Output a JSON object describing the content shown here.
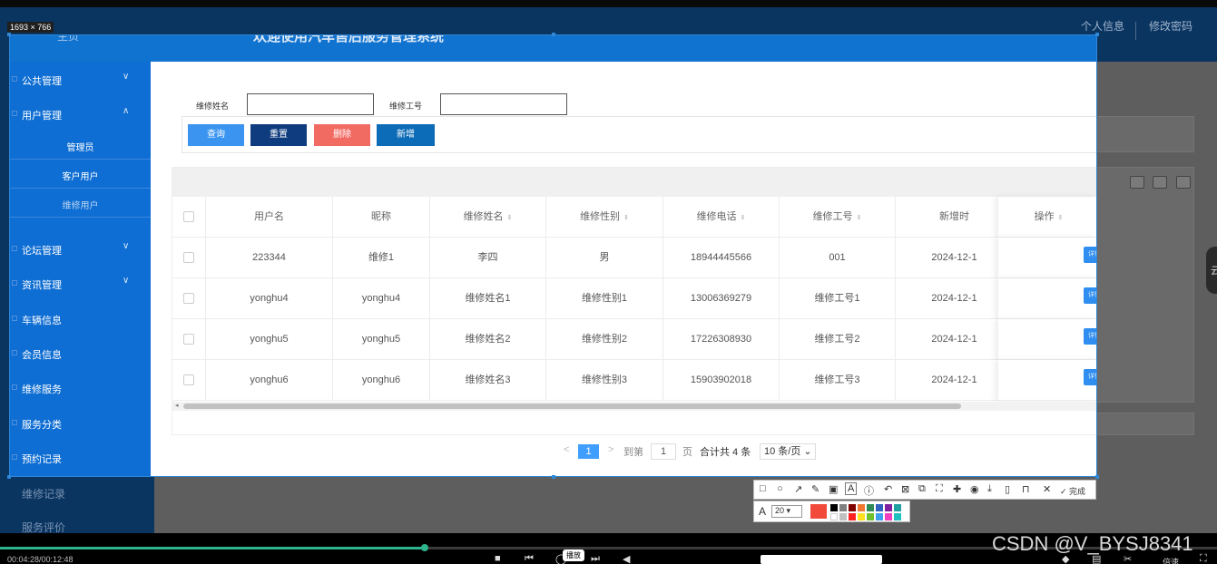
{
  "bg": {
    "top_links": [
      "个人信息",
      "修改密码"
    ],
    "sidebar_items": [
      "维修记录",
      "服务评价"
    ]
  },
  "capture": {
    "size_label": "1693 × 766",
    "home": "主页",
    "title": "欢迎使用汽车售后服务管理系统"
  },
  "sidebar": {
    "groups": [
      {
        "label": "公共管理",
        "chevron": "∨"
      },
      {
        "label": "用户管理",
        "chevron": "∧"
      }
    ],
    "sub_items": [
      "管理员",
      "客户用户",
      "维修用户"
    ],
    "items": [
      {
        "label": "论坛管理",
        "chevron": "∨"
      },
      {
        "label": "资讯管理",
        "chevron": "∨"
      },
      {
        "label": "车辆信息",
        "chevron": ""
      },
      {
        "label": "会员信息",
        "chevron": ""
      },
      {
        "label": "维修服务",
        "chevron": ""
      },
      {
        "label": "服务分类",
        "chevron": ""
      },
      {
        "label": "预约记录",
        "chevron": ""
      }
    ]
  },
  "search": {
    "name_label": "维修姓名",
    "id_label": "维修工号",
    "name_value": "",
    "id_value": ""
  },
  "buttons": {
    "query": "查询",
    "reset": "重置",
    "delete": "删除",
    "add": "新增"
  },
  "table": {
    "columns": [
      "用户名",
      "昵称",
      "维修姓名",
      "维修性别",
      "维修电话",
      "维修工号",
      "新增时"
    ],
    "sortable": [
      false,
      false,
      true,
      true,
      true,
      true,
      false
    ],
    "op_header": "操作",
    "sort_icon": "⇕",
    "detail_label": "详情",
    "rows": [
      [
        "223344",
        "维修1",
        "李四",
        "男",
        "18944445566",
        "001",
        "2024-12-1"
      ],
      [
        "yonghu4",
        "yonghu4",
        "维修姓名1",
        "维修性别1",
        "13006369279",
        "维修工号1",
        "2024-12-1"
      ],
      [
        "yonghu5",
        "yonghu5",
        "维修姓名2",
        "维修性别2",
        "17226308930",
        "维修工号2",
        "2024-12-1"
      ],
      [
        "yonghu6",
        "yonghu6",
        "维修姓名3",
        "维修性别3",
        "15903902018",
        "维修工号3",
        "2024-12-1"
      ]
    ]
  },
  "pager": {
    "prev": "<",
    "current": "1",
    "next": ">",
    "goto": "到第",
    "page_input": "1",
    "page_unit": "页",
    "total": "合计共 4 条",
    "per_page": "10 条/页 ⌄"
  },
  "annotate": {
    "done": "完成",
    "font_size": "20 ▾",
    "font_icon": "A"
  },
  "player": {
    "time": "00:04:28/00:12:48",
    "play_tip": "播放",
    "speed": "倍速",
    "watermark": "CSDN @V_BYSJ8341",
    "handle_char": "云"
  },
  "colors": {
    "sidebar": "#0f6ed3",
    "header": "#1173d0",
    "query_btn": "#3b95f0",
    "reset_btn": "#0f3c7f",
    "delete_btn": "#f26b63",
    "add_btn": "#0c6cb8",
    "accent": "#409eff",
    "progress": "#2fb58d"
  }
}
